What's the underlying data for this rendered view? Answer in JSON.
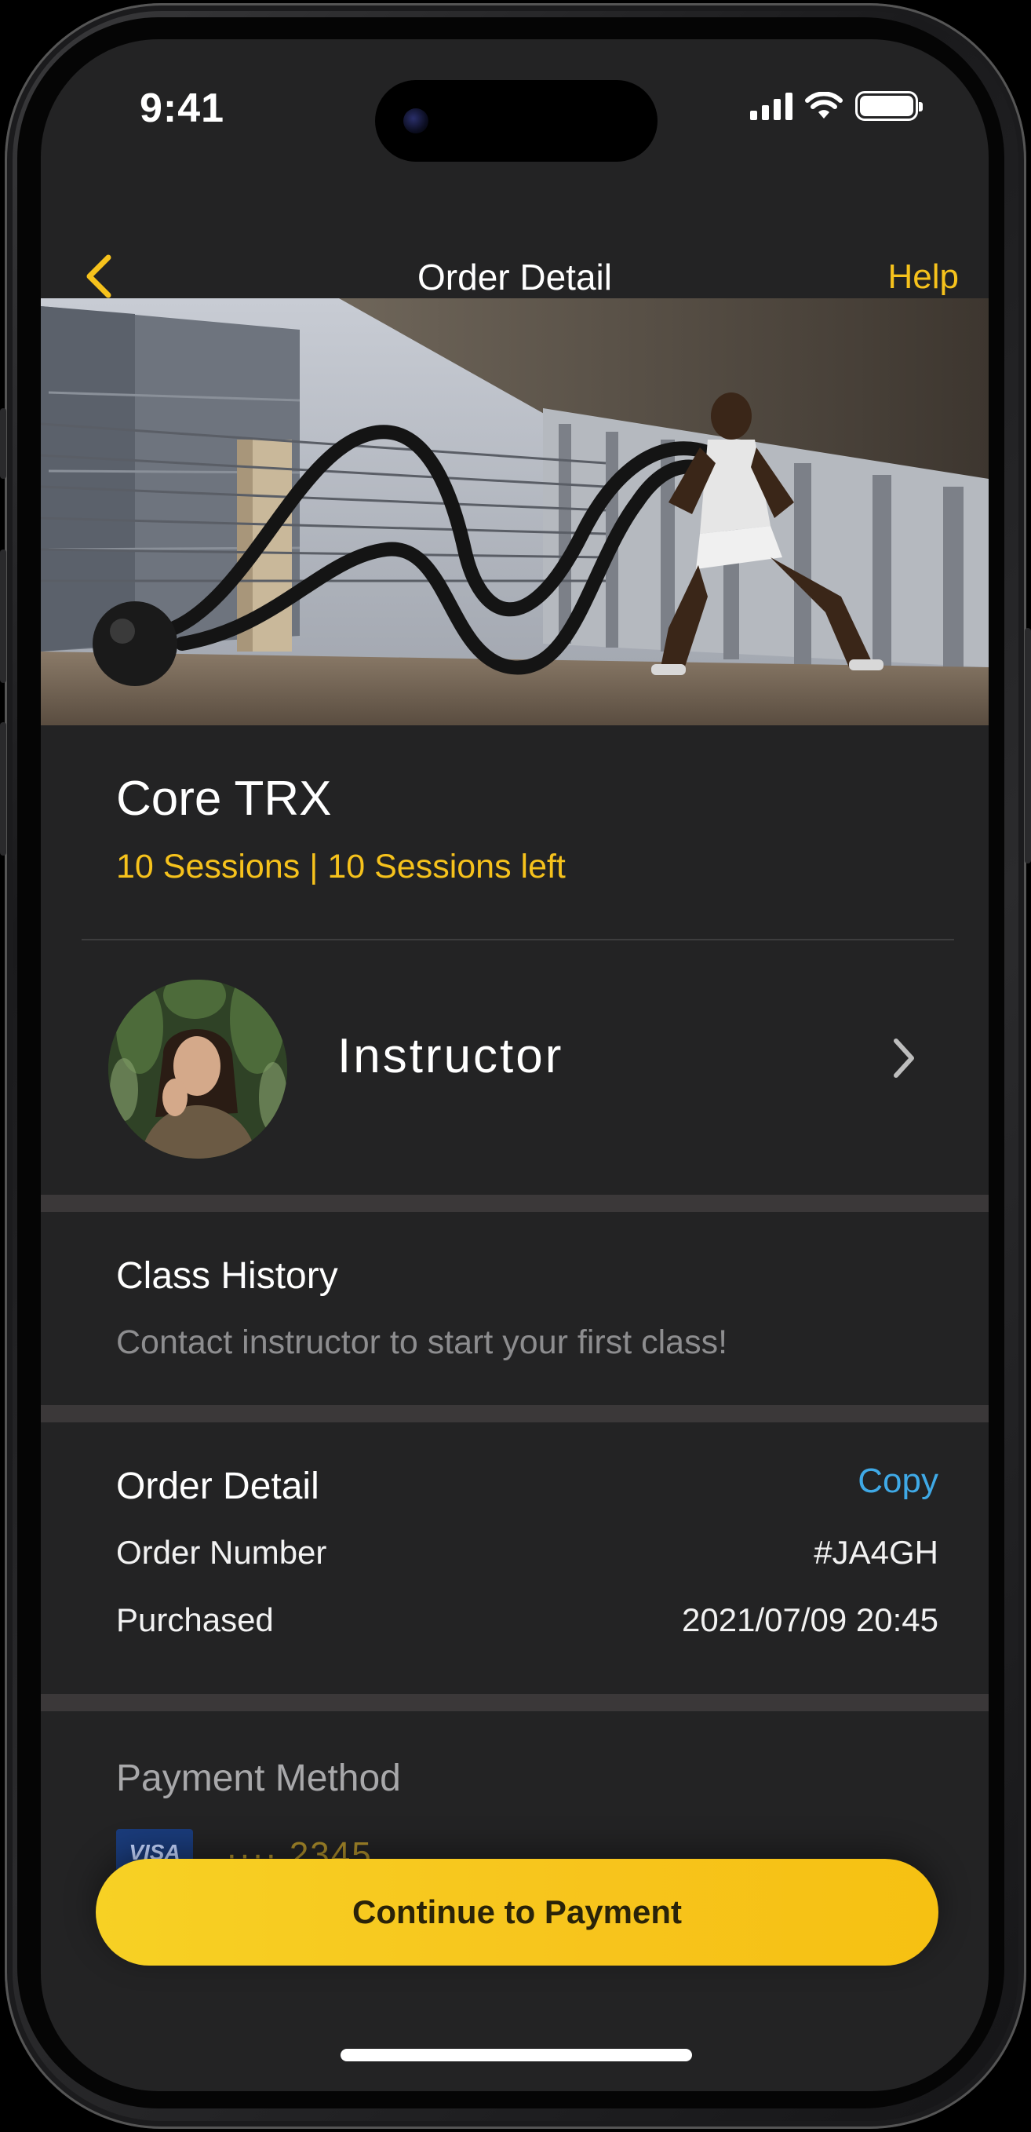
{
  "status_bar": {
    "time": "9:41"
  },
  "nav": {
    "title": "Order Detail",
    "help_label": "Help"
  },
  "hero": {
    "image": "battle-ropes-workout-photo"
  },
  "class": {
    "title": "Core TRX",
    "sessions": "10 Sessions | 10 Sessions left"
  },
  "instructor": {
    "label": "Instructor"
  },
  "class_history": {
    "title": "Class History",
    "message": "Contact instructor to start your first class!"
  },
  "order_detail": {
    "title": "Order Detail",
    "copy_label": "Copy",
    "rows": [
      {
        "label": "Order Number",
        "value": "#JA4GH"
      },
      {
        "label": "Purchased",
        "value": "2021/07/09 20:45"
      }
    ]
  },
  "payment": {
    "title": "Payment Method",
    "card_brand": "VISA",
    "card_last": "···· 2345"
  },
  "cta": {
    "label": "Continue to Payment"
  },
  "colors": {
    "accent": "#f6c21c",
    "link": "#3fa9e6",
    "background": "#232324",
    "separator": "#3b3839"
  }
}
